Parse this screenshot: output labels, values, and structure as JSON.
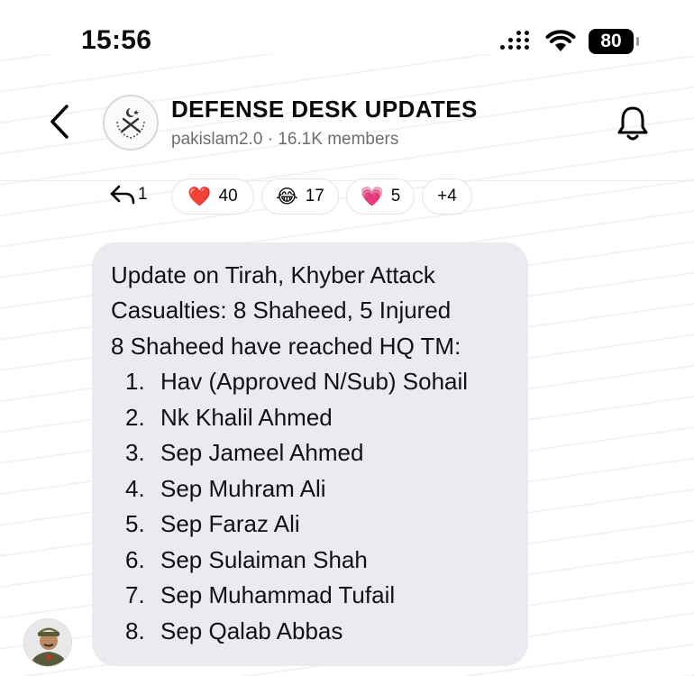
{
  "status_bar": {
    "time": "15:56",
    "battery": "80"
  },
  "header": {
    "title": "DEFENSE DESK UPDATES",
    "meta": "pakislam2.0 · 16.1K members"
  },
  "reactions": {
    "reply_count": "1",
    "items": [
      {
        "emoji": "❤️",
        "count": "40"
      },
      {
        "emoji": "😂",
        "count": "17"
      },
      {
        "emoji": "💗",
        "count": "5"
      }
    ],
    "more": "+4"
  },
  "message": {
    "lines": [
      "Update on Tirah, Khyber Attack",
      "Casualties: 8 Shaheed, 5 Injured",
      "8 Shaheed have reached HQ TM:"
    ],
    "list": [
      {
        "num": "1.",
        "text": "Hav (Approved N/Sub) Sohail"
      },
      {
        "num": "2.",
        "text": "Nk Khalil Ahmed"
      },
      {
        "num": "3.",
        "text": "Sep Jameel Ahmed"
      },
      {
        "num": "4.",
        "text": "Sep Muhram Ali"
      },
      {
        "num": "5.",
        "text": "Sep Faraz Ali"
      },
      {
        "num": "6.",
        "text": "Sep Sulaiman Shah"
      },
      {
        "num": "7.",
        "text": "Sep Muhammad Tufail"
      },
      {
        "num": "8.",
        "text": "Sep Qalab Abbas"
      }
    ]
  },
  "colors": {
    "bubble": "#e9ebf0",
    "meta_text": "#6e6e73",
    "heart": "#e0245e"
  }
}
